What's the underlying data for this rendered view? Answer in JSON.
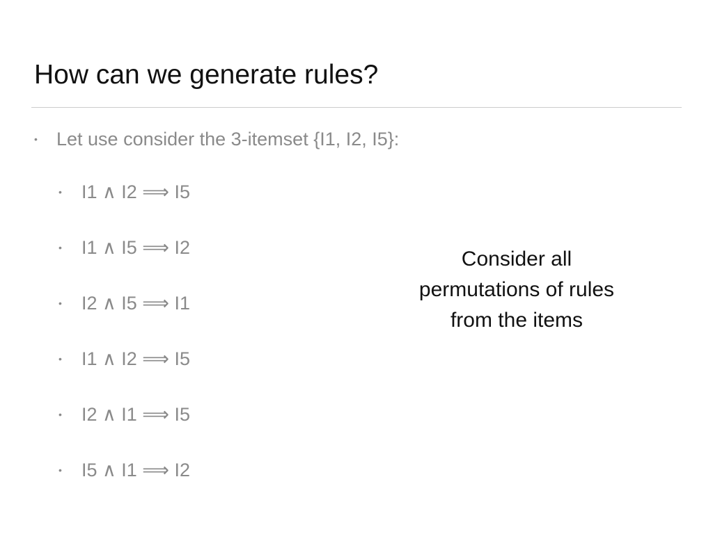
{
  "slide": {
    "title": "How can we generate rules?",
    "intro_bullet": "Let use consider the 3-itemset {I1, I2, I5}:",
    "rules": [
      "I1 ∧ I2 ⟹ I5",
      "I1 ∧ I5 ⟹ I2",
      "I2 ∧ I5 ⟹ I1",
      "I1 ∧ I2 ⟹ I5",
      "I2 ∧ I1 ⟹ I5",
      "I5 ∧ I1 ⟹ I2"
    ],
    "side_note": "Consider all permutations of rules from the items",
    "bullet_glyph": "•"
  },
  "colors": {
    "title_text": "#111111",
    "body_text": "#8a8a8a",
    "divider": "#cccccc",
    "background": "#ffffff"
  }
}
